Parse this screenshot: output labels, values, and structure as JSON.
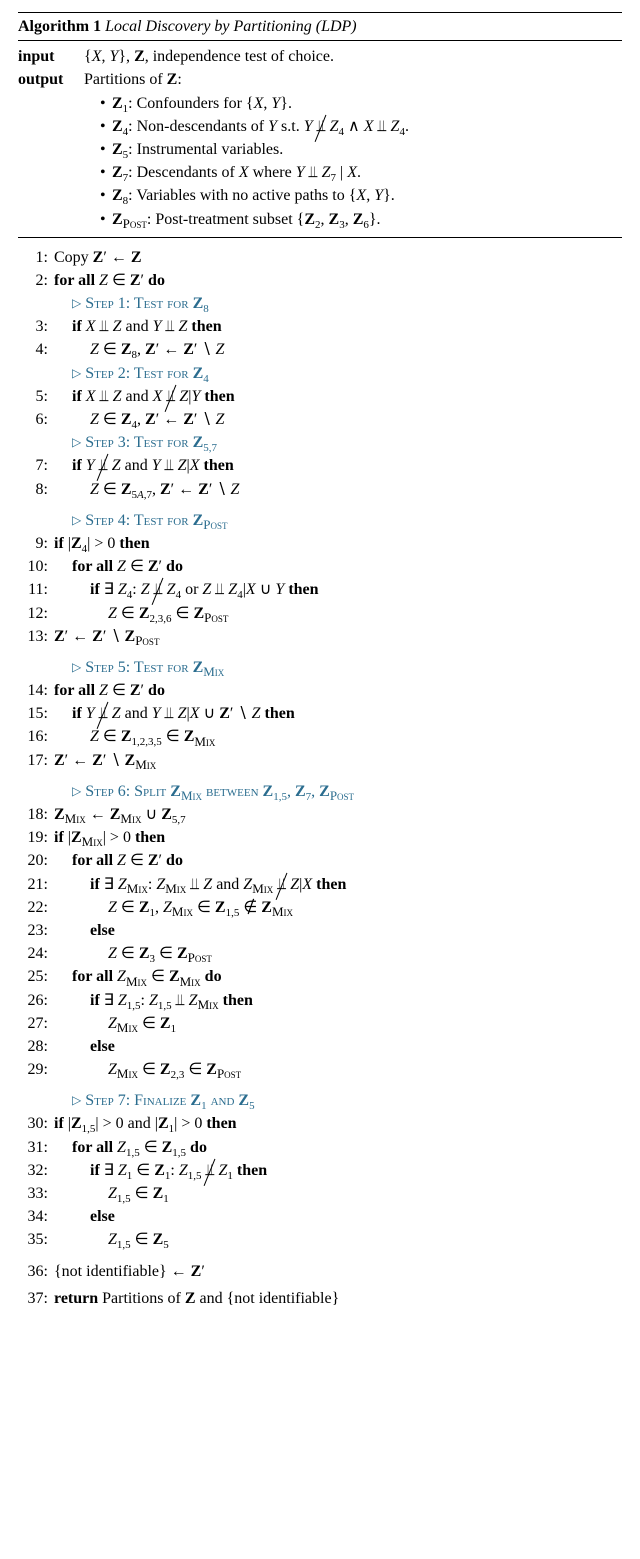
{
  "algo": {
    "number": "Algorithm 1",
    "name": "Local Discovery by Partitioning (LDP)"
  },
  "input_label": "input",
  "output_label": "output",
  "input_text": "{X, Y}, Z, independence test of choice.",
  "output_header": "Partitions of Z:",
  "outputs": [
    "Z₁: Confounders for {X, Y}.",
    "Z₄: Non-descendants of Y s.t. Y ⫫̸ Z₄ ∧ X ⫫ Z₄.",
    "Z₅: Instrumental variables.",
    "Z₇: Descendants of X where Y ⫫ Z₇ | X.",
    "Z₈: Variables with no active paths to {X, Y}.",
    "Z_POST: Post-treatment subset {Z₂, Z₃, Z₆}."
  ],
  "steps": {
    "s1": "Step 1: Test for Z₈",
    "s2": "Step 2: Test for Z₄",
    "s3": "Step 3: Test for Z₅,₇",
    "s4": "Step 4: Test for Z_POST",
    "s5": "Step 5: Test for Z_MIX",
    "s6": "Step 6: Split Z_MIX between Z₁,₅, Z₇, Z_POST",
    "s7": "Step 7: Finalize Z₁ and Z₅"
  },
  "lines": {
    "l1": "Copy Z′ ← Z",
    "l2": "for all Z ∈ Z′ do",
    "l3": "if X ⫫ Z and Y ⫫ Z then",
    "l4": "Z ∈ Z₈, Z′ ← Z′ ∖ Z",
    "l5": "if X ⫫ Z and X ⫫̸ Z|Y then",
    "l6": "Z ∈ Z₄, Z′ ← Z′ ∖ Z",
    "l7": "if Y ⫫̸ Z and Y ⫫ Z|X then",
    "l8": "Z ∈ Z₅A,₇, Z′ ← Z′ ∖ Z",
    "l9": "if |Z₄| > 0 then",
    "l10": "for all Z ∈ Z′ do",
    "l11": "if ∃ Z₄: Z ⫫̸ Z₄ or Z ⫫ Z₄|X ∪ Y then",
    "l12": "Z ∈ Z₂,₃,₆ ∈ Z_POST",
    "l13": "Z′ ← Z′ ∖ Z_POST",
    "l14": "for all Z ∈ Z′ do",
    "l15": "if Y ⫫̸ Z and Y ⫫ Z|X ∪ Z′ ∖ Z then",
    "l16": "Z ∈ Z₁,₂,₃,₅ ∈ Z_MIX",
    "l17": "Z′ ← Z′ ∖ Z_MIX",
    "l18": "Z_MIX ← Z_MIX ∪ Z₅,₇",
    "l19": "if |Z_MIX| > 0 then",
    "l20": "for all Z ∈ Z′ do",
    "l21": "if ∃ Z_MIX: Z_MIX ⫫ Z and Z_MIX ⫫̸ Z|X then",
    "l22": "Z ∈ Z₁, Z_MIX ∈ Z₁,₅ ∉ Z_MIX",
    "l23": "else",
    "l24": "Z ∈ Z₃ ∈ Z_POST",
    "l25": "for all Z_MIX ∈ Z_MIX do",
    "l26": "if ∃ Z₁,₅: Z₁,₅ ⫫ Z_MIX then",
    "l27": "Z_MIX ∈ Z₁",
    "l28": "else",
    "l29": "Z_MIX ∈ Z₂,₃ ∈ Z_POST",
    "l30": "if |Z₁,₅| > 0 and |Z₁| > 0 then",
    "l31": "for all Z₁,₅ ∈ Z₁,₅ do",
    "l32": "if ∃ Z₁ ∈ Z₁: Z₁,₅ ⫫̸ Z₁ then",
    "l33": "Z₁,₅ ∈ Z₁",
    "l34": "else",
    "l35": "Z₁,₅ ∈ Z₅",
    "l36": "{not identifiable} ← Z′",
    "l37": "return Partitions of Z and {not identifiable}"
  }
}
